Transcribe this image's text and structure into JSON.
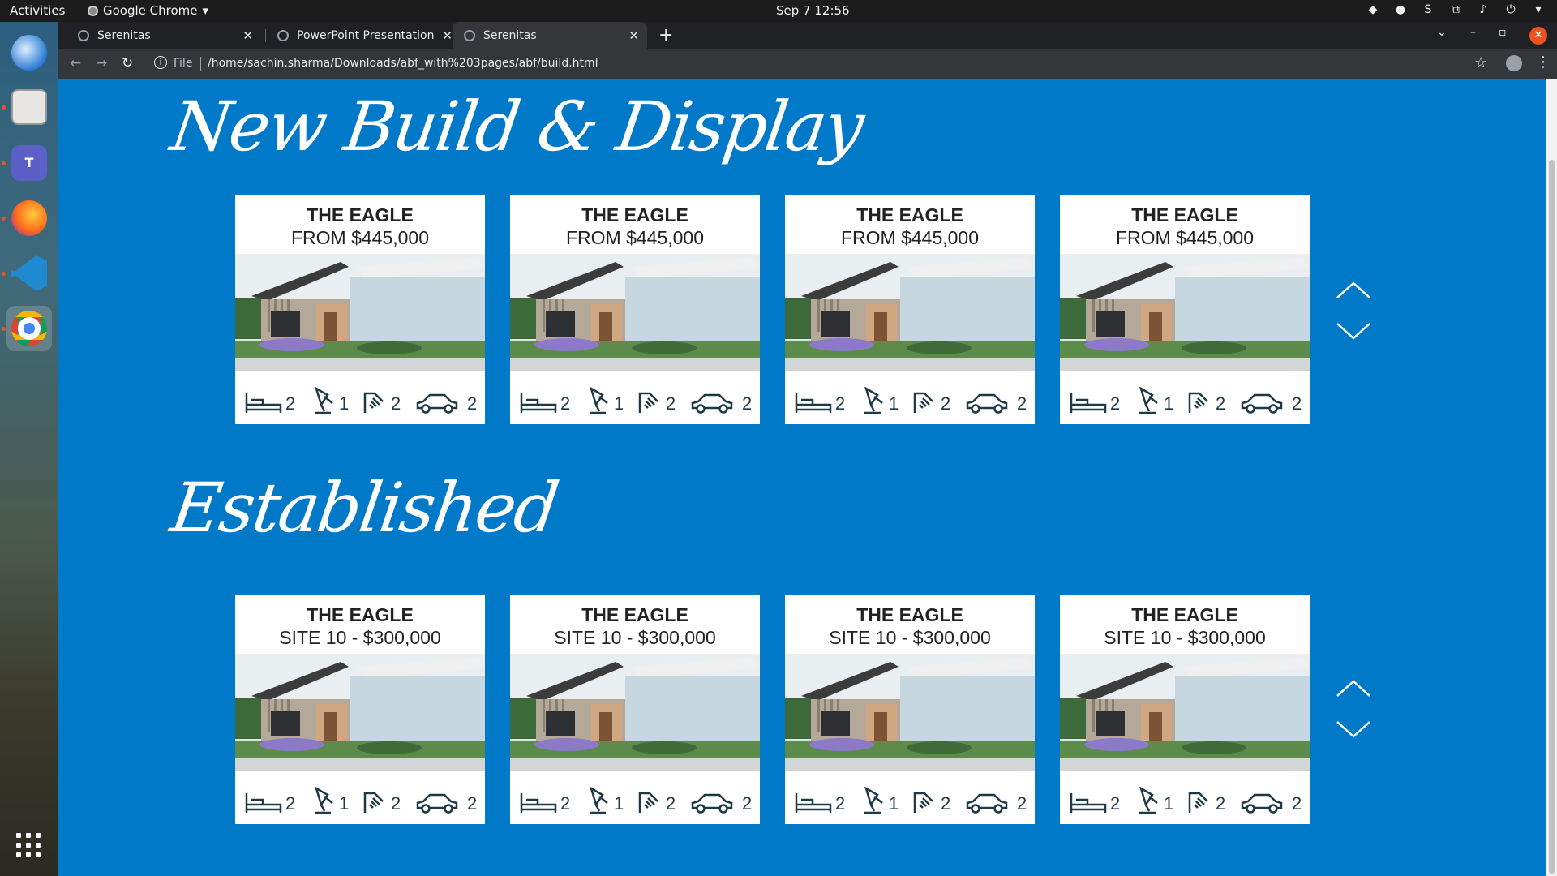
{
  "desktop": {
    "activities": "Activities",
    "app_menu": "Google Chrome",
    "clock": "Sep 7  12:56"
  },
  "browser": {
    "tabs": [
      {
        "title": "Serenitas",
        "active": false
      },
      {
        "title": "PowerPoint Presentation",
        "active": false
      },
      {
        "title": "Serenitas",
        "active": true
      }
    ],
    "scheme_label": "File",
    "url": "/home/sachin.sharma/Downloads/abf_with%203pages/abf/build.html"
  },
  "sections": [
    {
      "title": "New Build & Display",
      "cards": [
        {
          "name": "THE EAGLE",
          "price": "FROM $445,000",
          "beds": "2",
          "baths": "1",
          "showers": "2",
          "cars": "2"
        },
        {
          "name": "THE EAGLE",
          "price": "FROM $445,000",
          "beds": "2",
          "baths": "1",
          "showers": "2",
          "cars": "2"
        },
        {
          "name": "THE EAGLE",
          "price": "FROM $445,000",
          "beds": "2",
          "baths": "1",
          "showers": "2",
          "cars": "2"
        },
        {
          "name": "THE EAGLE",
          "price": "FROM $445,000",
          "beds": "2",
          "baths": "1",
          "showers": "2",
          "cars": "2"
        }
      ]
    },
    {
      "title": "Established",
      "cards": [
        {
          "name": "THE EAGLE",
          "price": "SITE 10 - $300,000",
          "beds": "2",
          "baths": "1",
          "showers": "2",
          "cars": "2"
        },
        {
          "name": "THE EAGLE",
          "price": "SITE 10 - $300,000",
          "beds": "2",
          "baths": "1",
          "showers": "2",
          "cars": "2"
        },
        {
          "name": "THE EAGLE",
          "price": "SITE 10 - $300,000",
          "beds": "2",
          "baths": "1",
          "showers": "2",
          "cars": "2"
        },
        {
          "name": "THE EAGLE",
          "price": "SITE 10 - $300,000",
          "beds": "2",
          "baths": "1",
          "showers": "2",
          "cars": "2"
        }
      ]
    }
  ],
  "colors": {
    "page_bg": "#0079c8",
    "accent": "#e95420",
    "icon": "#1f3a46"
  }
}
